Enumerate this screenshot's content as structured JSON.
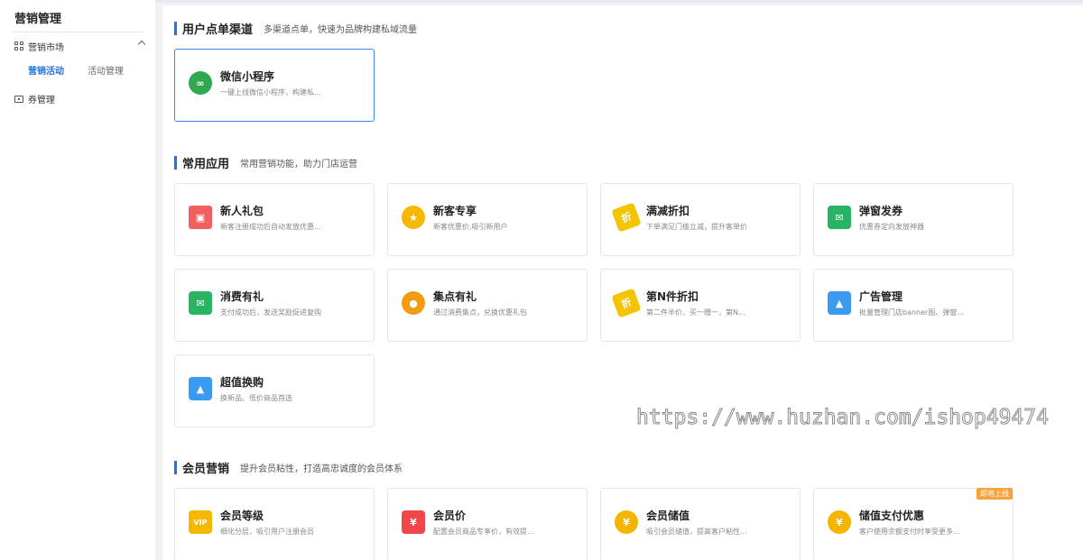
{
  "sidebar": {
    "title": "营销管理",
    "group_label": "营销市场",
    "sub_items": [
      {
        "label": "营销活动"
      },
      {
        "label": "活动管理"
      }
    ],
    "ticket_label": "券管理"
  },
  "sections": {
    "channels": {
      "title": "用户点单渠道",
      "desc": "多渠道点单，快速为品牌构建私域流量",
      "cards": [
        {
          "name": "微信小程序",
          "desc": "一键上线微信小程序，构建私..."
        }
      ]
    },
    "common": {
      "title": "常用应用",
      "desc": "常用营销功能，助力门店运营",
      "cards": [
        {
          "name": "新人礼包",
          "desc": "新客注册成功后自动发放优惠..."
        },
        {
          "name": "新客专享",
          "desc": "新客优惠价,吸引新用户"
        },
        {
          "name": "满减折扣",
          "desc": "下单满足门槛立减，提升客单价"
        },
        {
          "name": "弹窗发券",
          "desc": "优惠券定向发放神器"
        },
        {
          "name": "消费有礼",
          "desc": "支付成功后，发送奖励促进复购"
        },
        {
          "name": "集点有礼",
          "desc": "通过消费集点，兑换优惠礼包"
        },
        {
          "name": "第N件折扣",
          "desc": "第二件半价、买一赠一，第N..."
        },
        {
          "name": "广告管理",
          "desc": "批量管理门店banner图、弹窗..."
        },
        {
          "name": "超值换购",
          "desc": "换新品、低价商品首选"
        }
      ]
    },
    "member": {
      "title": "会员营销",
      "desc": "提升会员粘性，打造高忠诚度的会员体系",
      "cards": [
        {
          "name": "会员等级",
          "desc": "细化分层，吸引用户注册会员"
        },
        {
          "name": "会员价",
          "desc": "配置会员商品专享价，有效提..."
        },
        {
          "name": "会员储值",
          "desc": "吸引会员储值，提高客户粘性..."
        },
        {
          "name": "储值支付优惠",
          "desc": "客户使用余额支付时享受更多..."
        }
      ],
      "badge": "即将上线"
    }
  },
  "watermark": "https://www.huzhan.com/ishop49474",
  "icons": {
    "wechat-mini": "mini-program-icon",
    "new-gift": "gift-icon",
    "new-exclusive": "medal-icon",
    "full-discount": "discount-tag-icon",
    "popup-coupon": "red-envelope-icon",
    "consume-gift": "envelope-icon",
    "points": "points-coin-icon",
    "nth-discount": "discount-tag-icon",
    "ads": "image-icon",
    "exchange": "image-icon",
    "member-level": "vip-card-icon",
    "member-price": "price-card-icon",
    "member-stored": "coin-icon",
    "stored-pay": "coin-icon"
  },
  "colors": {
    "accent": "#1a73e8",
    "badge": "#f7a23b"
  }
}
